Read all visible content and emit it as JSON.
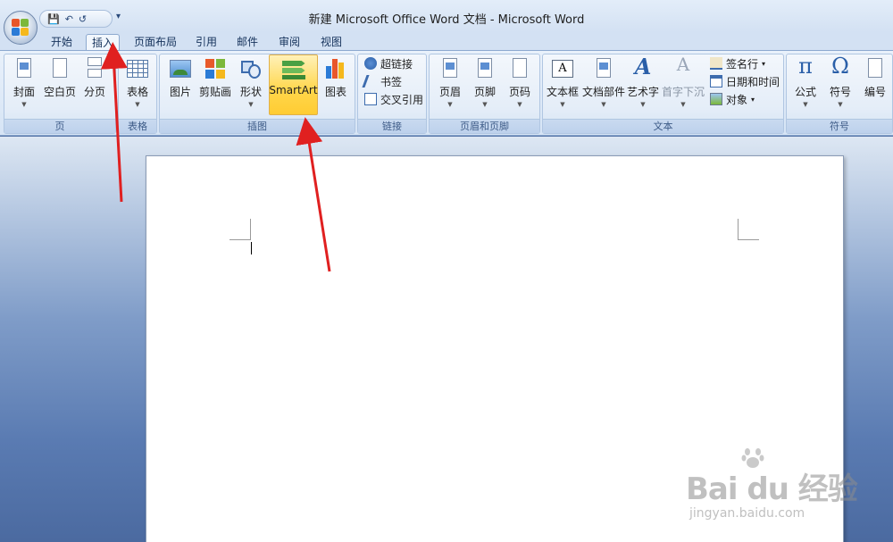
{
  "window": {
    "title": "新建 Microsoft Office Word 文档 - Microsoft Word"
  },
  "qat": {
    "save_icon": "💾",
    "undo_icon": "↶",
    "redo_icon": "↺",
    "more": "▾"
  },
  "tabs": [
    {
      "label": "开始"
    },
    {
      "label": "插入",
      "active": true
    },
    {
      "label": "页面布局"
    },
    {
      "label": "引用"
    },
    {
      "label": "邮件"
    },
    {
      "label": "审阅"
    },
    {
      "label": "视图"
    }
  ],
  "ribbon": {
    "groups": {
      "pages": {
        "label": "页",
        "cover": "封面",
        "blank": "空白页",
        "break": "分页"
      },
      "tables": {
        "label": "表格",
        "table": "表格"
      },
      "illustrations": {
        "label": "插图",
        "picture": "图片",
        "clipart": "剪贴画",
        "shapes": "形状",
        "smartart": "SmartArt",
        "chart": "图表"
      },
      "links": {
        "label": "链接",
        "hyperlink": "超链接",
        "bookmark": "书签",
        "crossref": "交叉引用"
      },
      "headerfooter": {
        "label": "页眉和页脚",
        "header": "页眉",
        "footer": "页脚",
        "pagenum": "页码"
      },
      "text": {
        "label": "文本",
        "textbox": "文本框",
        "quickparts": "文档部件",
        "wordart": "艺术字",
        "dropcap": "首字下沉",
        "signature": "签名行",
        "datetime": "日期和时间",
        "object": "对象"
      },
      "symbols": {
        "label": "符号",
        "equation": "公式",
        "symbol": "符号",
        "numbering": "编号",
        "pi": "π",
        "omega": "Ω"
      }
    }
  },
  "watermark": {
    "main": "Bai du 经验",
    "sub": "jingyan.baidu.com"
  },
  "colors": {
    "ribbon": "#e4edf8",
    "highlight": "#ffd64a",
    "arrow": "#e02020"
  }
}
